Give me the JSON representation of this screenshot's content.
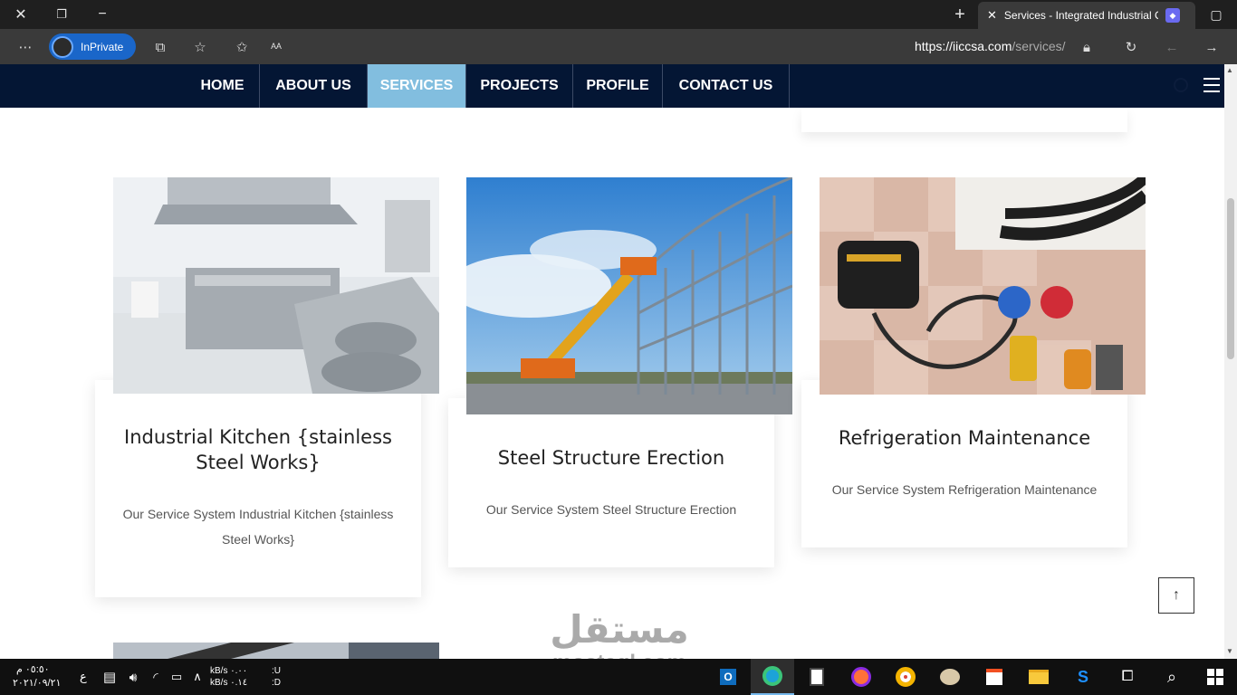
{
  "browser": {
    "tab_title": "Services - Integrated Industrial C",
    "inprivate_label": "InPrivate",
    "url_host": "https://iiccsa.com",
    "url_path": "/services/"
  },
  "nav": {
    "items": [
      "HOME",
      "ABOUT US",
      "SERVICES",
      "PROJECTS",
      "PROFILE",
      "CONTACT US"
    ],
    "active": "SERVICES"
  },
  "cards": [
    {
      "title": "Industrial Kitchen {stainless Steel Works}",
      "desc": "Our Service System Industrial Kitchen {stainless Steel Works}"
    },
    {
      "title": "Steel Structure Erection",
      "desc": "Our Service System Steel Structure Erection"
    },
    {
      "title": "Refrigeration Maintenance",
      "desc": "Our Service System Refrigeration Maintenance"
    }
  ],
  "watermark": {
    "arabic": "مستقل",
    "latin": "mostaql.com"
  },
  "taskbar": {
    "time": "٠٥:٥٠ م",
    "date": "٢٠٢١/٠٩/٢١",
    "lang": "ع",
    "net_up": "kB/s ٠.٠٠",
    "net_down": "kB/s ٠.١٤",
    "drive_u": ":U",
    "drive_d": ":D"
  },
  "colors": {
    "nav_bg": "#041634",
    "nav_active": "#82bedf",
    "inprivate": "#1a66c9"
  }
}
